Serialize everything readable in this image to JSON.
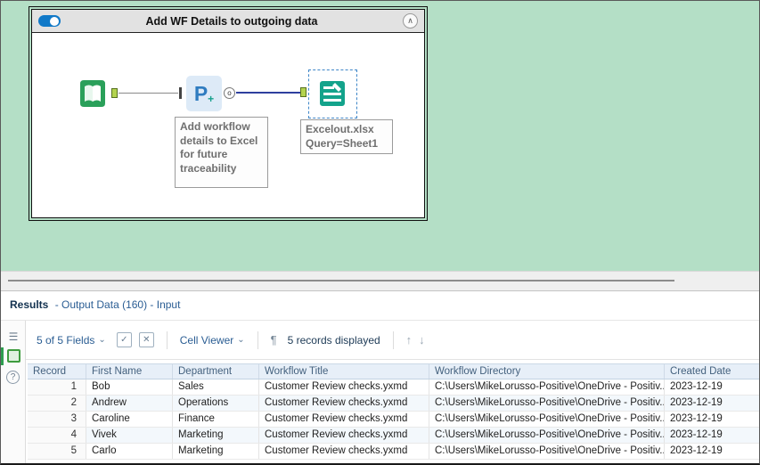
{
  "icons": {
    "collapse": "∧",
    "dropdown": "⌄",
    "check": "✓",
    "cross": "✕",
    "pilcrow": "¶",
    "up_arrow": "↑",
    "down_arrow": "↓",
    "list": "☰",
    "help": "?",
    "anchor_out_label": "o"
  },
  "canvas": {
    "container": {
      "title": "Add WF Details to outgoing data",
      "tools": {
        "python_label": "P",
        "python_plus": "+"
      },
      "annotations": {
        "python": "Add workflow details to Excel for future traceability",
        "output": "Excelout.xlsx\nQuery=Sheet1"
      }
    }
  },
  "results": {
    "title": "Results",
    "subtitle": "- Output Data (160) - Input",
    "toolbar": {
      "fields": "5 of 5 Fields",
      "cell_viewer": "Cell Viewer",
      "records": "5 records displayed"
    },
    "table": {
      "columns": [
        "Record",
        "First Name",
        "Department",
        "Workflow Title",
        "Workflow Directory",
        "Created Date"
      ],
      "rows": [
        [
          "1",
          "Bob",
          "Sales",
          "Customer Review checks.yxmd",
          "C:\\Users\\MikeLorusso-Positive\\OneDrive - Positiv...",
          "2023-12-19"
        ],
        [
          "2",
          "Andrew",
          "Operations",
          "Customer Review checks.yxmd",
          "C:\\Users\\MikeLorusso-Positive\\OneDrive - Positiv...",
          "2023-12-19"
        ],
        [
          "3",
          "Caroline",
          "Finance",
          "Customer Review checks.yxmd",
          "C:\\Users\\MikeLorusso-Positive\\OneDrive - Positiv...",
          "2023-12-19"
        ],
        [
          "4",
          "Vivek",
          "Marketing",
          "Customer Review checks.yxmd",
          "C:\\Users\\MikeLorusso-Positive\\OneDrive - Positiv...",
          "2023-12-19"
        ],
        [
          "5",
          "Carlo",
          "Marketing",
          "Customer Review checks.yxmd",
          "C:\\Users\\MikeLorusso-Positive\\OneDrive - Positiv...",
          "2023-12-19"
        ]
      ]
    }
  },
  "colors": {
    "canvas_green": "#b4dfc6",
    "selection_blue": "#3e86c8",
    "tool_green": "#2aa05a",
    "tool_teal": "#13a38b",
    "accent_blue": "#2a5d93"
  }
}
